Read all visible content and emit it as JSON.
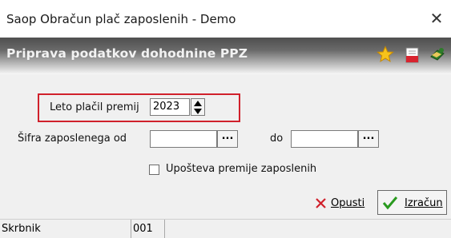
{
  "window": {
    "title": "Saop Obračun plač zaposlenih - Demo",
    "close_glyph": "✕"
  },
  "header": {
    "title": "Priprava podatkov dohodnine PPZ",
    "icons": [
      "star-icon",
      "pdf-document-icon",
      "run-program-icon"
    ]
  },
  "form": {
    "year_label": "Leto plačil premij",
    "year_value": "2023",
    "employee_from_label": "Šifra zaposlenega od",
    "employee_from_value": "",
    "employee_to_label": "do",
    "employee_to_value": "",
    "ellipsis": "...",
    "consider_checkbox_label": "Upošteva premije zaposlenih",
    "consider_checkbox_checked": false
  },
  "buttons": {
    "cancel_label": "Opusti",
    "calculate_label": "Izračun"
  },
  "status": {
    "cell1": "Skrbnik",
    "cell2": "001"
  },
  "colors": {
    "highlight": "#d0202b",
    "cancel_icon": "#d0202b",
    "check_icon": "#2a9a1f"
  }
}
